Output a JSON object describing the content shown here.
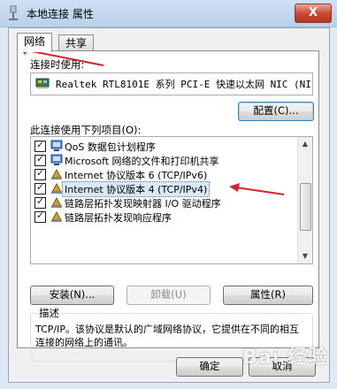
{
  "window": {
    "title": "本地连接 属性",
    "close_glyph": "X"
  },
  "tabs": [
    {
      "label": "网络"
    },
    {
      "label": "共享"
    }
  ],
  "connect_using": {
    "label": "连接时使用:",
    "adapter": "Realtek RTL8101E 系列 PCI-E 快速以太网 NIC (NI",
    "configure_button": "配置(C)..."
  },
  "items_section": {
    "label": "此连接使用下列项目(O):",
    "items": [
      {
        "label": "QoS 数据包计划程序",
        "checked": true,
        "icon": "network-service-icon"
      },
      {
        "label": "Microsoft 网络的文件和打印机共享",
        "checked": true,
        "icon": "network-service-icon"
      },
      {
        "label": "Internet 协议版本 6 (TCP/IPv6)",
        "checked": true,
        "icon": "protocol-icon"
      },
      {
        "label": "Internet 协议版本 4 (TCP/IPv4)",
        "checked": true,
        "icon": "protocol-icon",
        "selected": true
      },
      {
        "label": "链路层拓扑发现映射器 I/O 驱动程序",
        "checked": true,
        "icon": "protocol-icon"
      },
      {
        "label": "链路层拓扑发现响应程序",
        "checked": true,
        "icon": "protocol-icon"
      }
    ]
  },
  "action_buttons": {
    "install": "安装(N)...",
    "uninstall": "卸载(U)",
    "properties": "属性(R)"
  },
  "description": {
    "title": "描述",
    "text": "TCP/IP。该协议是默认的广域网络协议，它提供在不同的相互连接的网络上的通讯。"
  },
  "footer": {
    "ok": "确定",
    "cancel": "取消"
  },
  "watermark": "Bai 经验",
  "colors": {
    "annotation_arrow": "#d3242b",
    "selection_outline": "#3a6ea5"
  }
}
